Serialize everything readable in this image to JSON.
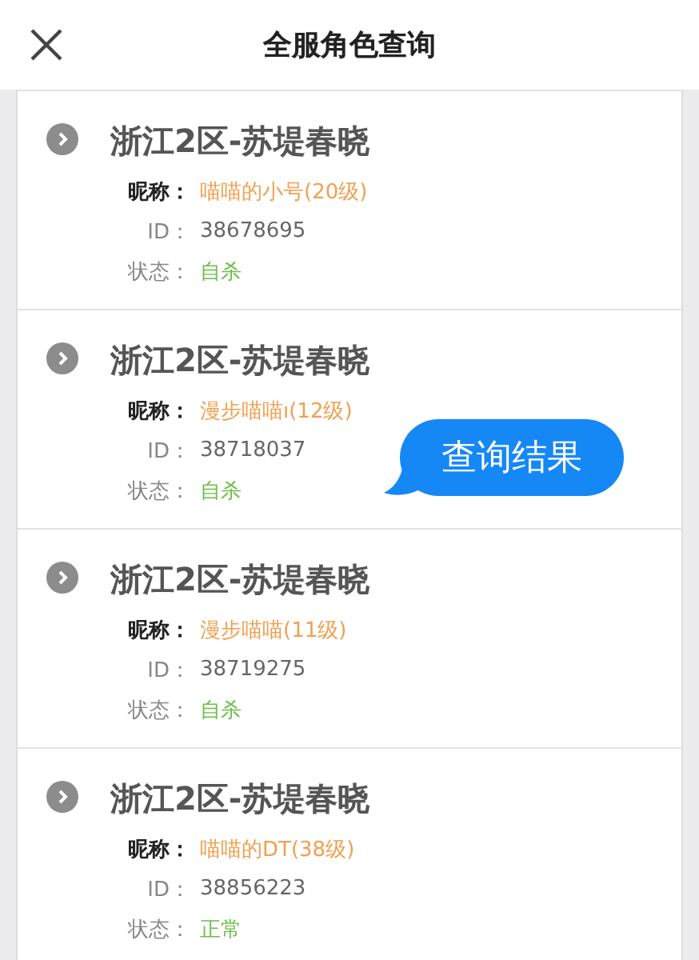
{
  "header": {
    "title": "全服角色查询"
  },
  "results": [
    {
      "server": "浙江2区-苏堤春晓",
      "nickname_label": "昵称：",
      "nickname": "喵喵的小号(20级)",
      "id_label": "ID：",
      "id": "38678695",
      "status_label": "状态：",
      "status": "自杀"
    },
    {
      "server": "浙江2区-苏堤春晓",
      "nickname_label": "昵称：",
      "nickname": "漫步喵喵ı(12级)",
      "id_label": "ID：",
      "id": "38718037",
      "status_label": "状态：",
      "status": "自杀"
    },
    {
      "server": "浙江2区-苏堤春晓",
      "nickname_label": "昵称：",
      "nickname": "漫步喵喵(11级)",
      "id_label": "ID：",
      "id": "38719275",
      "status_label": "状态：",
      "status": "自杀"
    },
    {
      "server": "浙江2区-苏堤春晓",
      "nickname_label": "昵称：",
      "nickname": "喵喵的DT(38级)",
      "id_label": "ID：",
      "id": "38856223",
      "status_label": "状态：",
      "status": "正常"
    }
  ],
  "callout": {
    "text": "查询结果"
  }
}
